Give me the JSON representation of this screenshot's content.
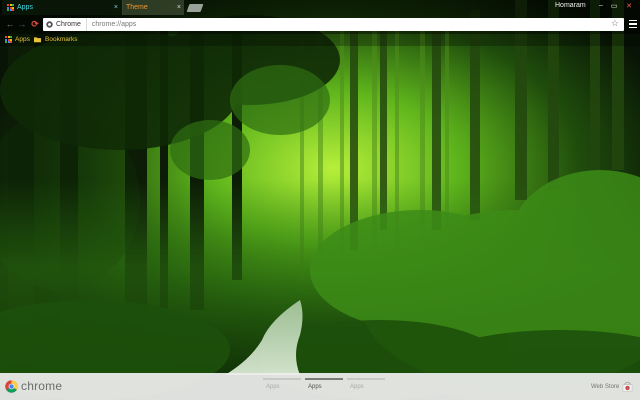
{
  "tabs": [
    {
      "label": "Apps",
      "close": "×"
    },
    {
      "label": "Theme",
      "close": "×"
    }
  ],
  "window": {
    "profile": "Homaram",
    "minimize": "–",
    "maximize": "▭",
    "close": "✕"
  },
  "toolbar": {
    "back": "←",
    "forward": "→",
    "reload": "⟳"
  },
  "omnibox": {
    "chip_label": "Chrome",
    "url": "chrome://apps",
    "star": "☆"
  },
  "bookmarks": [
    {
      "label": "Apps"
    },
    {
      "label": "Bookmarks"
    }
  ],
  "bottom": {
    "brand": "chrome",
    "pages": [
      {
        "label": "Apps"
      },
      {
        "label": "Apps"
      },
      {
        "label": "Apps"
      }
    ],
    "webstore": "Web Store"
  },
  "colors": {
    "tab_text": "#3fd9e6",
    "tab2_text": "#f0962d",
    "bookmark_text": "#e7c23a",
    "reload": "#e04a3a"
  },
  "icons": [
    "apps-grid-icon",
    "close-icon",
    "new-tab-icon",
    "back-icon",
    "forward-icon",
    "reload-icon",
    "chrome-icon",
    "star-icon",
    "menu-icon",
    "folder-icon",
    "chrome-logo-icon",
    "webstore-icon"
  ]
}
